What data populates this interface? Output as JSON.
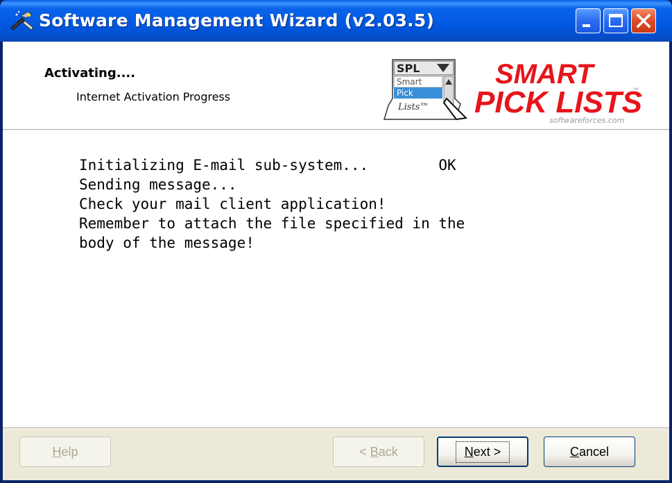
{
  "window": {
    "title": "Software Management Wizard (v2.03.5)",
    "controls": {
      "minimize_icon": "minimize-icon",
      "maximize_icon": "maximize-icon",
      "close_icon": "close-icon"
    }
  },
  "header": {
    "title": "Activating....",
    "subtitle": "Internet Activation Progress",
    "logo": {
      "spl": "SPL",
      "list_items": [
        "Smart",
        "Pick",
        "Lists™"
      ],
      "brand_line1": "SMART",
      "brand_line2": "PICK LISTS",
      "tm": "™",
      "site": "softwareforces.com"
    }
  },
  "log": {
    "lines": [
      "Initializing E-mail sub-system...        OK",
      "Sending message...",
      "Check your mail client application!",
      "Remember to attach the file specified in the",
      "body of the message!"
    ]
  },
  "buttons": {
    "help": {
      "prefix": "",
      "accel": "H",
      "rest": "elp",
      "enabled": false
    },
    "back": {
      "prefix": "< ",
      "accel": "B",
      "rest": "ack",
      "enabled": false
    },
    "next": {
      "prefix": "",
      "accel": "N",
      "rest": "ext >",
      "enabled": true
    },
    "cancel": {
      "prefix": "",
      "accel": "C",
      "rest": "ancel",
      "enabled": true
    }
  },
  "colors": {
    "titlebar": "#0058e0",
    "dialog_bg": "#ece9d8",
    "brand_red": "#e8141b"
  }
}
